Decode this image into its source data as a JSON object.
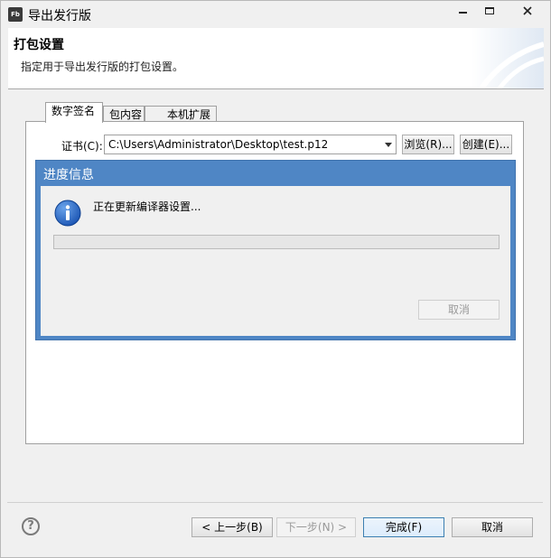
{
  "window": {
    "title": "导出发行版",
    "app_icon_text": "Fb"
  },
  "banner": {
    "title": "打包设置",
    "description": "指定用于导出发行版的打包设置。"
  },
  "tabs": [
    {
      "label": "数字签名",
      "active": true
    },
    {
      "label": "包内容",
      "active": false
    },
    {
      "label": "本机扩展",
      "active": false
    }
  ],
  "certificate": {
    "label": "证书(C):",
    "value": "C:\\Users\\Administrator\\Desktop\\test.p12",
    "browse_label": "浏览(R)...",
    "create_label": "创建(E)..."
  },
  "progress_dialog": {
    "title": "进度信息",
    "message": "正在更新编译器设置...",
    "progress": 0,
    "cancel_label": "取消"
  },
  "footer": {
    "help_symbol": "?",
    "back_label": "< 上一步(B)",
    "next_label": "下一步(N) >",
    "finish_label": "完成(F)",
    "cancel_label": "取消"
  },
  "colors": {
    "dialog_header": "#4f86c5",
    "progress_fill": "#06b025"
  }
}
